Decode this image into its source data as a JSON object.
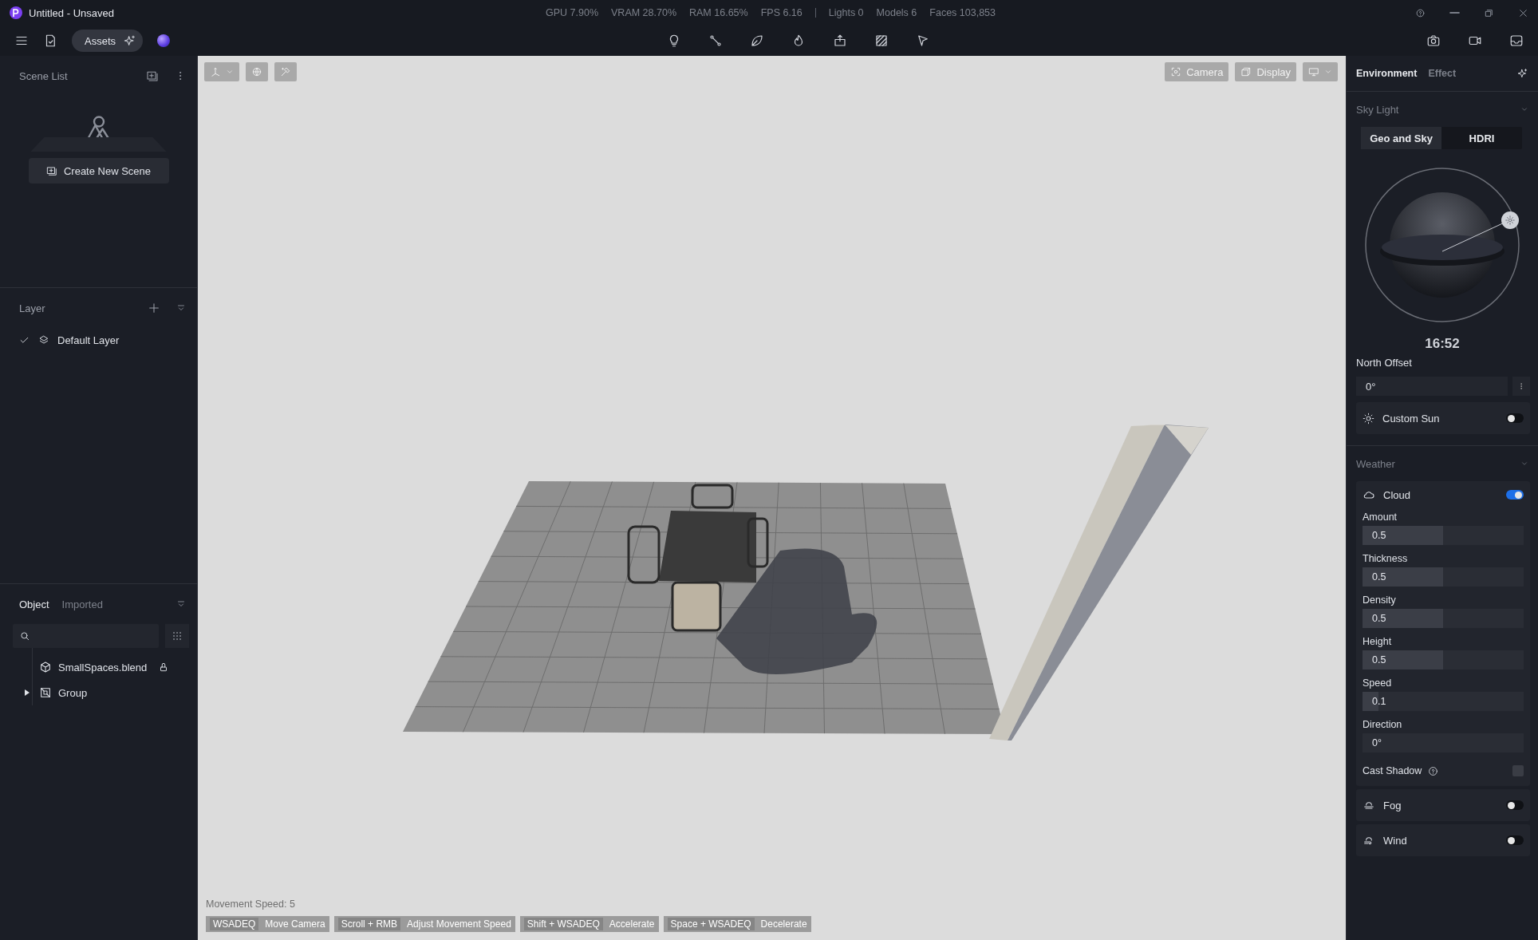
{
  "window": {
    "title": "Untitled - Unsaved"
  },
  "stats": [
    "GPU 7.90%",
    "VRAM 28.70%",
    "RAM 16.65%",
    "FPS 6.16"
  ],
  "counts": [
    "Lights 0",
    "Models 6",
    "Faces 103,853"
  ],
  "toolbar": {
    "assets_button": "Assets"
  },
  "scene_list": {
    "title": "Scene List",
    "create_button": "Create New Scene"
  },
  "layer": {
    "title": "Layer",
    "items": [
      {
        "name": "Default Layer",
        "checked": true
      }
    ]
  },
  "objects": {
    "tabs": [
      {
        "label": "Object",
        "selected": true
      },
      {
        "label": "Imported",
        "selected": false
      }
    ],
    "tree": [
      {
        "name": "SmallSpaces.blend",
        "kind": "file",
        "locked": true
      },
      {
        "name": "Group",
        "kind": "group",
        "expanded": false
      }
    ]
  },
  "viewport": {
    "camera_button": "Camera",
    "display_button": "Display",
    "movement_speed": "Movement Speed: 5",
    "shortcuts": [
      {
        "key": "WSADEQ",
        "action": "Move Camera"
      },
      {
        "key": "Scroll + RMB",
        "action": "Adjust Movement Speed"
      },
      {
        "key": "Shift + WSADEQ",
        "action": "Accelerate"
      },
      {
        "key": "Space + WSADEQ",
        "action": "Decelerate"
      }
    ]
  },
  "right_panel": {
    "tabs": [
      {
        "label": "Environment",
        "selected": true
      },
      {
        "label": "Effect",
        "selected": false
      }
    ],
    "sky_light": {
      "title": "Sky Light",
      "modes": [
        {
          "label": "Geo and Sky",
          "selected": true
        },
        {
          "label": "HDRI",
          "selected": false
        }
      ],
      "time": "16:52",
      "north_offset_label": "North Offset",
      "north_offset": "0°",
      "custom_sun": {
        "label": "Custom Sun",
        "on": false
      }
    },
    "weather": {
      "title": "Weather",
      "cloud": {
        "label": "Cloud",
        "on": true,
        "params": [
          {
            "label": "Amount",
            "value": "0.5",
            "kind": "slider",
            "level": 0.5
          },
          {
            "label": "Thickness",
            "value": "0.5",
            "kind": "slider",
            "level": 0.5
          },
          {
            "label": "Density",
            "value": "0.5",
            "kind": "slider",
            "level": 0.5
          },
          {
            "label": "Height",
            "value": "0.5",
            "kind": "slider",
            "level": 0.5
          },
          {
            "label": "Speed",
            "value": "0.1",
            "kind": "slider",
            "level": 0.1
          },
          {
            "label": "Direction",
            "value": "0°",
            "kind": "field"
          }
        ],
        "cast_shadow": {
          "label": "Cast Shadow",
          "checked": false
        }
      },
      "effects": [
        {
          "label": "Fog",
          "kind": "fog",
          "on": false
        },
        {
          "label": "Wind",
          "kind": "wind",
          "on": false
        }
      ]
    }
  }
}
